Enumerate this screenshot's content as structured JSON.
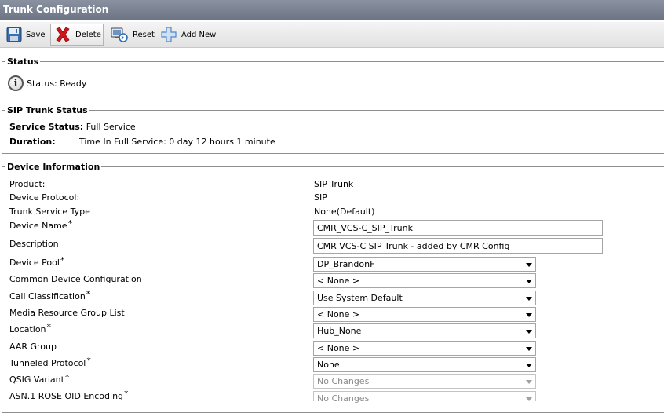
{
  "window": {
    "title": "Trunk Configuration"
  },
  "toolbar": {
    "save_label": "Save",
    "delete_label": "Delete",
    "reset_label": "Reset",
    "add_new_label": "Add New"
  },
  "status": {
    "legend": "Status",
    "text": "Status: Ready"
  },
  "sip_trunk_status": {
    "legend": "SIP Trunk Status",
    "service_status_label": "Service Status:",
    "service_status_value": "Full Service",
    "duration_label": "Duration:",
    "duration_value": "Time In Full Service: 0 day 12 hours 1 minute"
  },
  "device_info": {
    "legend": "Device Information",
    "product_label": "Product:",
    "product_value": "SIP Trunk",
    "protocol_label": "Device Protocol:",
    "protocol_value": "SIP",
    "service_type_label": "Trunk Service Type",
    "service_type_value": "None(Default)",
    "device_name_label": "Device Name",
    "device_name_value": "CMR_VCS-C_SIP_Trunk",
    "description_label": "Description",
    "description_value": "CMR VCS-C SIP Trunk - added by CMR Config",
    "device_pool_label": "Device Pool",
    "device_pool_value": "DP_BrandonF",
    "common_device_config_label": "Common Device Configuration",
    "common_device_config_value": "< None >",
    "call_classification_label": "Call Classification",
    "call_classification_value": "Use System Default",
    "mrgl_label": "Media Resource Group List",
    "mrgl_value": "< None >",
    "location_label": "Location",
    "location_value": "Hub_None",
    "aar_group_label": "AAR Group",
    "aar_group_value": "< None >",
    "tunneled_protocol_label": "Tunneled Protocol",
    "tunneled_protocol_value": "None",
    "qsig_variant_label": "QSIG Variant",
    "qsig_variant_value": "No Changes",
    "asn1_label": "ASN.1 ROSE OID Encoding",
    "asn1_value": "No Changes",
    "required_marker": "*"
  },
  "colors": {
    "titlebar": "#7a8292",
    "toolbar": "#ececec",
    "delete_icon": "#d0161b",
    "save_icon": "#3a6fb0",
    "add_icon": "#4f87c6"
  }
}
